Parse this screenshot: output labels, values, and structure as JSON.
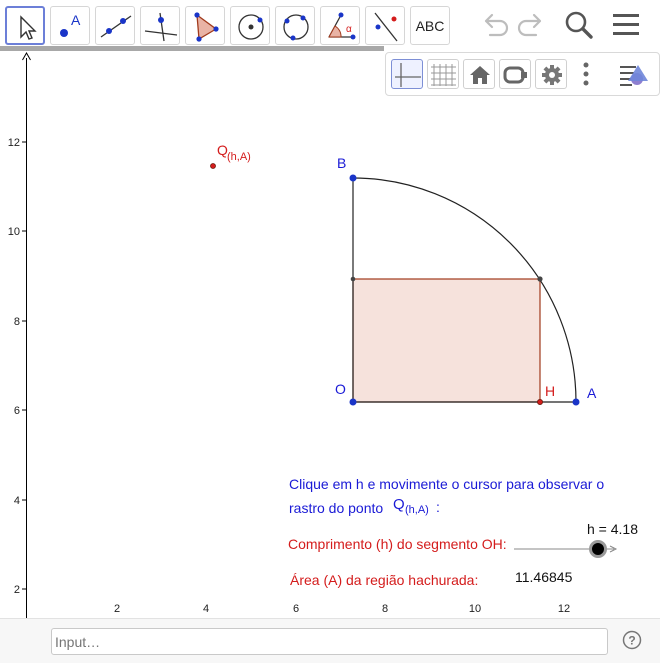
{
  "toolbar": {
    "tools": [
      {
        "name": "move-tool",
        "label": ""
      },
      {
        "name": "point-tool",
        "label": "A"
      },
      {
        "name": "line-tool",
        "label": ""
      },
      {
        "name": "perpendicular-line-tool",
        "label": ""
      },
      {
        "name": "polygon-tool",
        "label": ""
      },
      {
        "name": "circle-center-point-tool",
        "label": ""
      },
      {
        "name": "circle-three-points-tool",
        "label": ""
      },
      {
        "name": "angle-tool",
        "label": "α"
      },
      {
        "name": "reflect-about-line-tool",
        "label": ""
      },
      {
        "name": "text-tool",
        "label": "ABC"
      }
    ],
    "right_icons": [
      "undo-icon",
      "redo-icon",
      "search-icon",
      "menu-icon"
    ]
  },
  "stylebar": {
    "buttons": [
      "axes-icon",
      "grid-icon",
      "home-icon",
      "view-icon",
      "settings-icon",
      "more-icon",
      "style-icon"
    ]
  },
  "graph": {
    "y_ticks": [
      "2",
      "4",
      "6",
      "8",
      "10",
      "12"
    ],
    "x_ticks": [
      "2",
      "4",
      "6",
      "8",
      "10",
      "12"
    ],
    "labels": {
      "B": "B",
      "O": "O",
      "H": "H",
      "A": "A",
      "Q": "Q",
      "Q_sub": "(h,A)"
    },
    "text": {
      "instruction_line1": "Clique em h e movimente o cursor para observar o",
      "instruction_line2": "rastro do ponto",
      "instruction_Q": "Q",
      "instruction_Q_sub": "(h,A)",
      "instruction_colon": ":",
      "slider_value": "h = 4.18",
      "slider_label": "Comprimento (h) do segmento OH:",
      "area_label": "Área (A) da região hachurada:",
      "area_value": "11.46845"
    },
    "colors": {
      "blue_text": "#1a1ad6",
      "red_text": "#d41c1c",
      "point_blue": "#1a35c8",
      "rect_fill": "#f6e2dc",
      "rect_stroke": "#a13a1c"
    }
  },
  "slider_data": {
    "value": 4.18
  },
  "input_bar": {
    "placeholder": "Input…",
    "help_icon": "help-icon"
  }
}
